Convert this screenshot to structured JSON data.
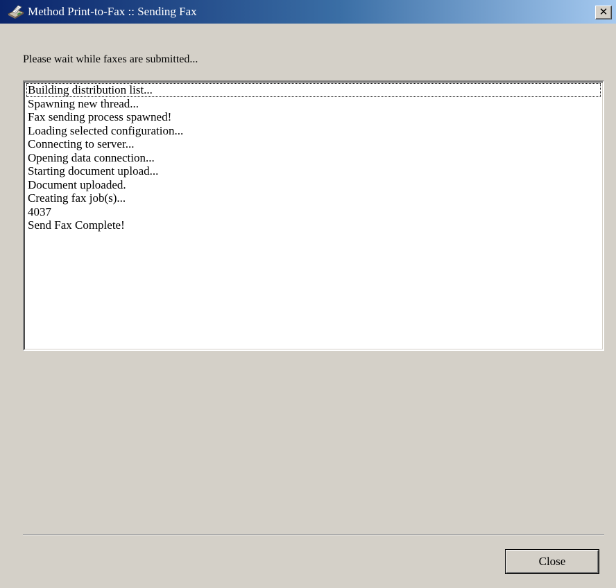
{
  "window": {
    "title": "Method Print-to-Fax :: Sending Fax",
    "close_glyph": "✕",
    "title_icon": "fax-machine-icon"
  },
  "prompt": "Please wait while faxes are submitted...",
  "log": {
    "lines": [
      "Building distribution list...",
      "Spawning new thread...",
      "Fax sending process spawned!",
      "Loading selected configuration...",
      "Connecting to server...",
      "Opening data connection...",
      "Starting document upload...",
      "Document uploaded.",
      "Creating fax job(s)...",
      "4037",
      "Send Fax Complete!"
    ]
  },
  "buttons": {
    "close_label": "Close"
  },
  "colors": {
    "titlebar_start": "#0a246a",
    "titlebar_end": "#a6caf0",
    "window_bg": "#d4d0c8"
  }
}
